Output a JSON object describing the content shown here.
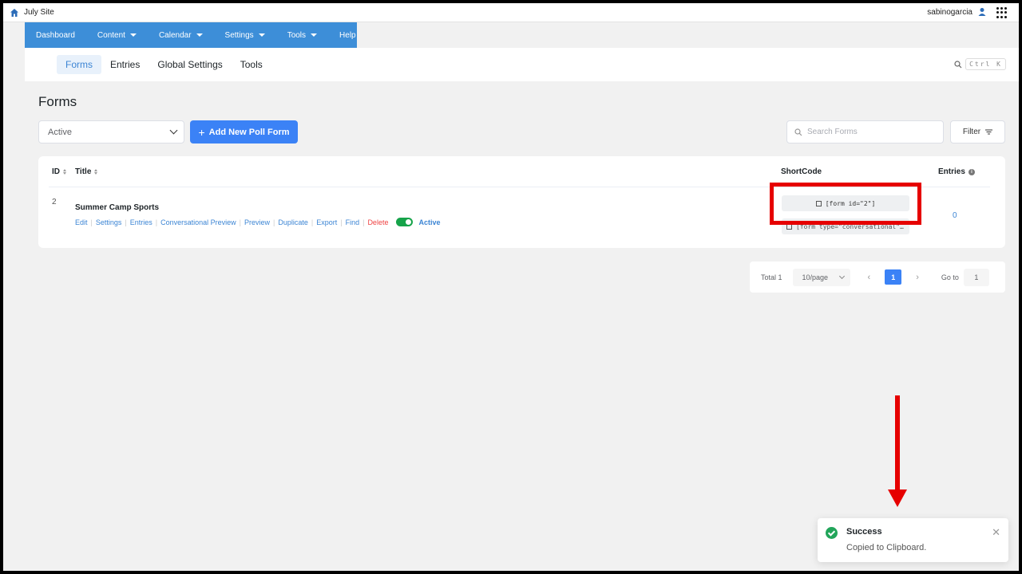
{
  "topbar": {
    "site_name": "July Site",
    "username": "sabinogarcia"
  },
  "mainnav": [
    {
      "label": "Dashboard",
      "dropdown": false
    },
    {
      "label": "Content",
      "dropdown": true
    },
    {
      "label": "Calendar",
      "dropdown": true
    },
    {
      "label": "Settings",
      "dropdown": true
    },
    {
      "label": "Tools",
      "dropdown": true
    },
    {
      "label": "Help",
      "dropdown": false
    }
  ],
  "subnav": {
    "tabs": [
      "Forms",
      "Entries",
      "Global Settings",
      "Tools"
    ],
    "search_shortcut": "Ctrl K"
  },
  "page": {
    "title": "Forms",
    "status_select": "Active",
    "add_button": "Add New Poll Form",
    "search_placeholder": "Search Forms",
    "filter_label": "Filter"
  },
  "table": {
    "headers": {
      "id": "ID",
      "title": "Title",
      "shortcode": "ShortCode",
      "entries": "Entries"
    },
    "rows": [
      {
        "id": "2",
        "title": "Summer Camp Sports",
        "actions": [
          "Edit",
          "Settings",
          "Entries",
          "Conversational Preview",
          "Preview",
          "Duplicate",
          "Export",
          "Find",
          "Delete"
        ],
        "status": "Active",
        "shortcode": "[form id=\"2\"]",
        "shortcode_conversational": "[form type=\"conversational\"…",
        "entries": "0"
      }
    ]
  },
  "pagination": {
    "total": "Total 1",
    "page_size": "10/page",
    "current_page": "1",
    "goto_label": "Go to",
    "goto_value": "1"
  },
  "toast": {
    "title": "Success",
    "message": "Copied to Clipboard."
  },
  "colors": {
    "nav_blue": "#3d8ed8",
    "primary": "#3b82f6",
    "annotation_red": "#e60000",
    "success": "#22a55a"
  }
}
